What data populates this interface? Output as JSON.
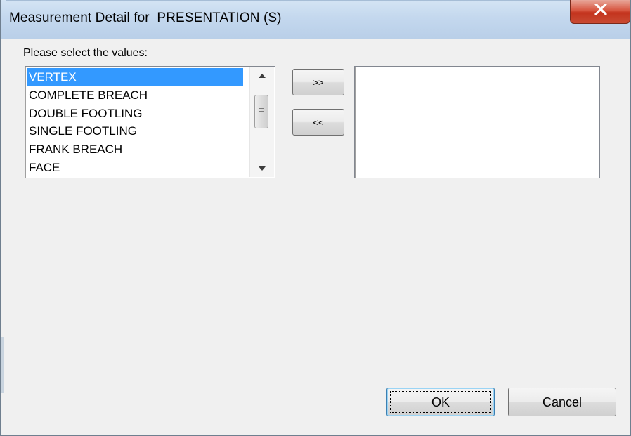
{
  "window": {
    "title": "Measurement Detail for  PRESENTATION (S)",
    "close_icon": "close-x-icon"
  },
  "dialog": {
    "prompt": "Please select the values:",
    "available_values": [
      {
        "label": "VERTEX",
        "selected": true
      },
      {
        "label": "COMPLETE BREACH",
        "selected": false
      },
      {
        "label": "DOUBLE FOOTLING",
        "selected": false
      },
      {
        "label": "SINGLE FOOTLING",
        "selected": false
      },
      {
        "label": "FRANK BREACH",
        "selected": false
      },
      {
        "label": "FACE",
        "selected": false
      }
    ],
    "selected_values": [],
    "add_button": ">>",
    "remove_button": "<<"
  },
  "footer": {
    "ok_label": "OK",
    "cancel_label": "Cancel"
  },
  "colors": {
    "selection": "#3399ff",
    "close_button": "#c3331d",
    "titlebar": "#c4d8ee"
  }
}
